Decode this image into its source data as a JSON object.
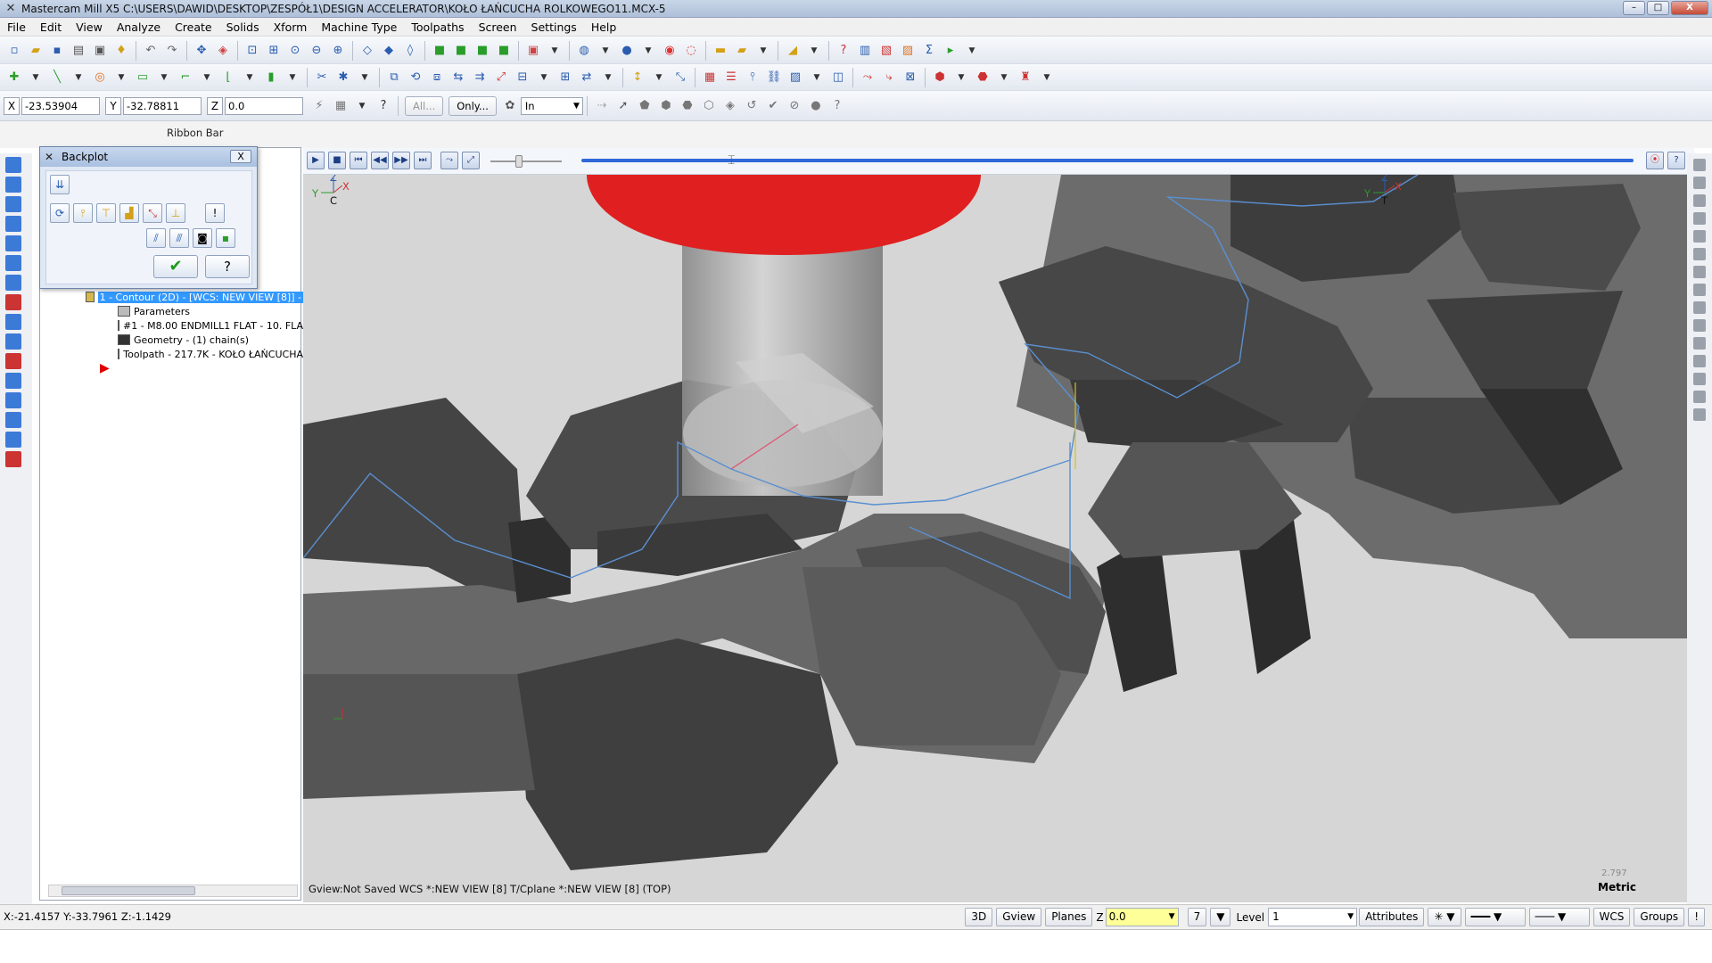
{
  "window": {
    "app_name": "Mastercam Mill X5",
    "file_path": "C:\\USERS\\DAWID\\DESKTOP\\ZESPÓŁ1\\DESIGN ACCELERATOR\\KOŁO ŁAŃCUCHA ROLKOWEGO11.MCX-5",
    "minimize": "–",
    "maximize": "□",
    "close": "X"
  },
  "menu": [
    "File",
    "Edit",
    "View",
    "Analyze",
    "Create",
    "Solids",
    "Xform",
    "Machine Type",
    "Toolpaths",
    "Screen",
    "Settings",
    "Help"
  ],
  "autocursor": {
    "x_label": "X",
    "x_value": "-23.53904",
    "y_label": "Y",
    "y_value": "-32.78811",
    "z_label": "Z",
    "z_value": "0.0",
    "all_button": "All...",
    "only_button": "Only...",
    "units_select": "In"
  },
  "ribbon_bar_label": "Ribbon Bar",
  "backplot": {
    "title": "Backplot",
    "close": "X"
  },
  "ops_tree": {
    "items": [
      {
        "label": "1 - Contour (2D) - [WCS: NEW VIEW [8]] -"
      },
      {
        "label": "Parameters"
      },
      {
        "label": "#1 - M8.00 ENDMILL1 FLAT -    10. FLA"
      },
      {
        "label": "Geometry - (1) chain(s)"
      },
      {
        "label": "Toolpath - 217.7K - KOŁO ŁAŃCUCHA"
      }
    ]
  },
  "viewport": {
    "gview_status": "Gview:Not Saved   WCS *:NEW VIEW [8]   T/Cplane *:NEW VIEW [8] (TOP)",
    "scale_value": "2.797",
    "units_label": "Metric",
    "axis_labels": {
      "z": "Z",
      "y": "Y",
      "x": "X",
      "c": "C",
      "t": "T"
    }
  },
  "status": {
    "cursor_coords": "X:-21.4157   Y:-33.7961   Z:-1.1429",
    "mode_3d": "3D",
    "gview": "Gview",
    "planes": "Planes",
    "z_label": "Z",
    "z_value": "0.0",
    "color_value": "7",
    "level_label": "Level",
    "level_value": "1",
    "attributes": "Attributes",
    "wcs": "WCS",
    "groups": "Groups"
  },
  "colors": {
    "tool_holder": "#e02020",
    "toolpath": "#5a8fd0",
    "part_dark": "#4a4a4a",
    "part_mid": "#6a6a6a",
    "selection": "#3399ff",
    "z_input_bg": "#ffff99"
  }
}
